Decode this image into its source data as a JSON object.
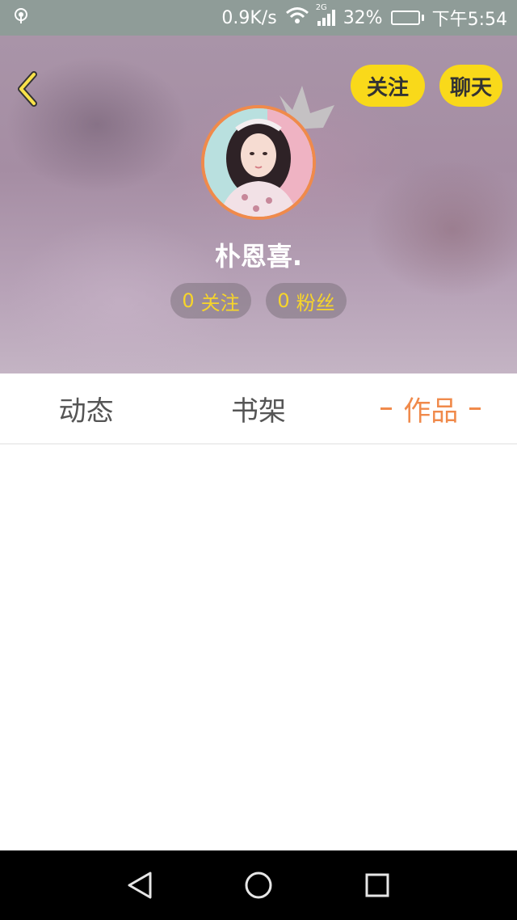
{
  "status_bar": {
    "net_speed": "0.9K/s",
    "network_type": "2G",
    "battery": "32%",
    "battery_level": 0.32,
    "time": "下午5:54",
    "icons": [
      "hotspot-icon",
      "wifi-icon",
      "signal-icon",
      "battery-icon"
    ]
  },
  "header": {
    "follow_label": "关注",
    "chat_label": "聊天",
    "username": "朴恩喜.",
    "stats": {
      "following_count": "0",
      "following_label": "关注",
      "fans_count": "0",
      "fans_label": "粉丝"
    },
    "icons": [
      "back-icon",
      "crown-icon"
    ]
  },
  "tabs": [
    {
      "label": "动态",
      "active": false
    },
    {
      "label": "书架",
      "active": false
    },
    {
      "label": "作品",
      "active": true
    }
  ],
  "nav_bar": {
    "icons": [
      "back-triangle-icon",
      "home-circle-icon",
      "recents-square-icon"
    ]
  },
  "colors": {
    "accent_yellow": "#f9d91a",
    "accent_orange": "#f08a4b",
    "stat_text": "#f7d52a"
  }
}
